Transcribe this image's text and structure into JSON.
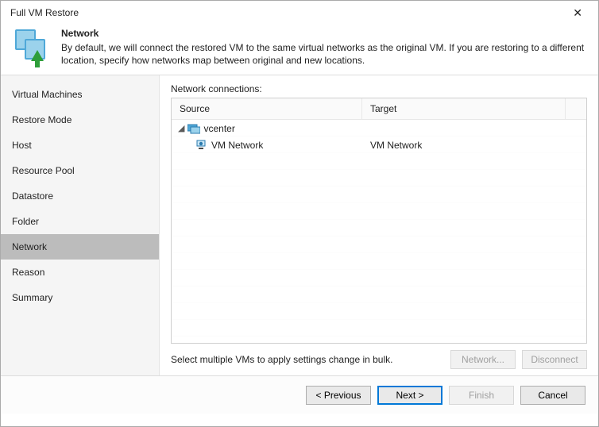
{
  "window": {
    "title": "Full VM Restore",
    "close_glyph": "✕"
  },
  "header": {
    "title": "Network",
    "description": "By default, we will connect the restored VM to the same virtual networks as the original VM. If you are restoring to a different location, specify how networks map between original and new locations."
  },
  "sidebar": {
    "items": [
      {
        "label": "Virtual Machines",
        "active": false
      },
      {
        "label": "Restore Mode",
        "active": false
      },
      {
        "label": "Host",
        "active": false
      },
      {
        "label": "Resource Pool",
        "active": false
      },
      {
        "label": "Datastore",
        "active": false
      },
      {
        "label": "Folder",
        "active": false
      },
      {
        "label": "Network",
        "active": true
      },
      {
        "label": "Reason",
        "active": false
      },
      {
        "label": "Summary",
        "active": false
      }
    ]
  },
  "main": {
    "label": "Network connections:",
    "columns": {
      "source": "Source",
      "target": "Target"
    },
    "tree": {
      "root": {
        "caret": "◢",
        "label": "vcenter"
      },
      "children": [
        {
          "source": "VM Network",
          "target": "VM Network"
        }
      ]
    },
    "hint": "Select multiple VMs to apply settings change in bulk.",
    "buttons": {
      "network": "Network...",
      "disconnect": "Disconnect"
    }
  },
  "footer": {
    "previous": "< Previous",
    "next": "Next >",
    "finish": "Finish",
    "cancel": "Cancel"
  }
}
